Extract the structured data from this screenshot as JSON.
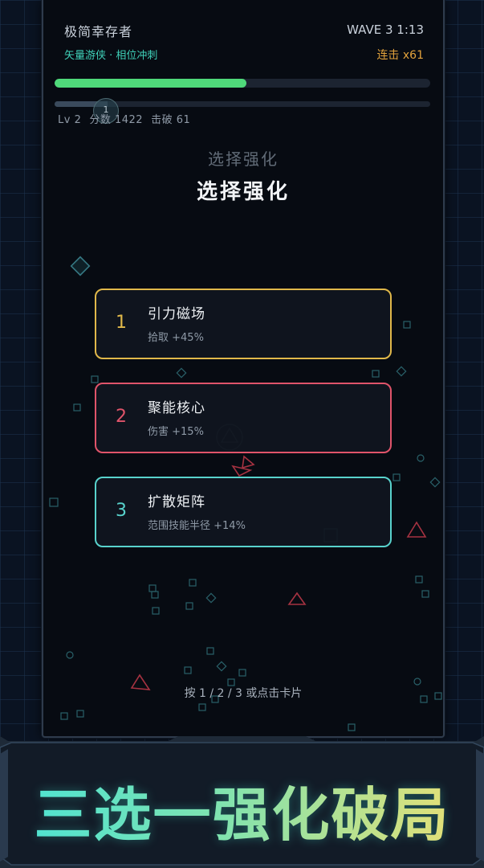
{
  "hud": {
    "title": "极简幸存者",
    "subtitle": "矢量游侠 · 相位冲刺",
    "wave": "WAVE 3  1:13",
    "combo": "连击 x61",
    "health_fraction": 0.51,
    "xp_fraction": 0.14,
    "level_badge": "1",
    "stats": {
      "level": "Lv 2",
      "score": "分数 1422",
      "kills": "击破 61"
    }
  },
  "overlay": {
    "ghost_title": "选择强化",
    "title": "选择强化",
    "hint": "按 1 / 2 / 3 或点击卡片"
  },
  "cards": [
    {
      "number": "1",
      "name": "引力磁场",
      "desc": "拾取 +45%",
      "color": "#e0b84a"
    },
    {
      "number": "2",
      "name": "聚能核心",
      "desc": "伤害 +15%",
      "color": "#e0546a"
    },
    {
      "number": "3",
      "name": "扩散矩阵",
      "desc": "范围技能半径 +14%",
      "color": "#58d2cc"
    }
  ],
  "banner": {
    "text": "三选一强化破局"
  },
  "colors": {
    "health": "#4fd97a",
    "accent": "#3fd0b8",
    "combo": "#e2a23c"
  }
}
